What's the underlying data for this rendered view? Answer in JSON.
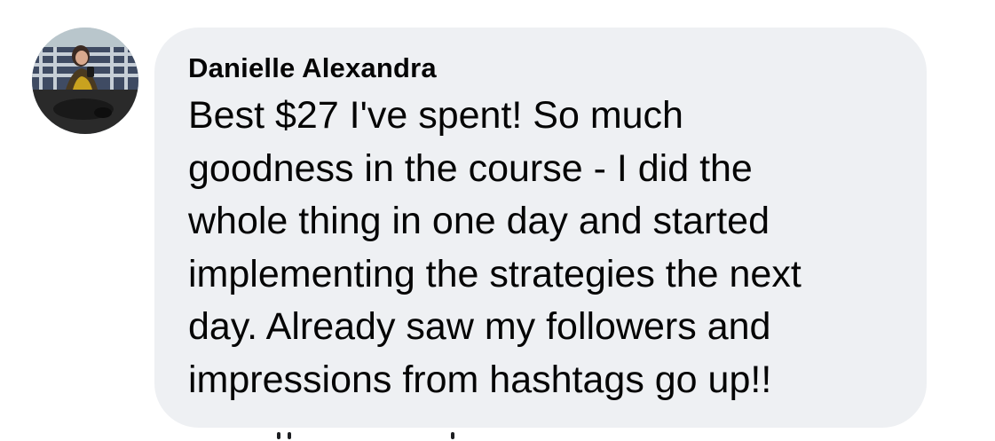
{
  "comment": {
    "author": "Danielle Alexandra",
    "body_lines": [
      "Best $27 I've spent! So much",
      "goodness in the course - I did the",
      "whole thing in one day and started",
      "implementing the strategies the next",
      "day. Already saw my followers and",
      "impressions from hashtags go up!!"
    ]
  },
  "colors": {
    "bubble_background": "#eef0f3",
    "text": "#050505"
  },
  "icons": {
    "avatar": "profile-photo"
  }
}
